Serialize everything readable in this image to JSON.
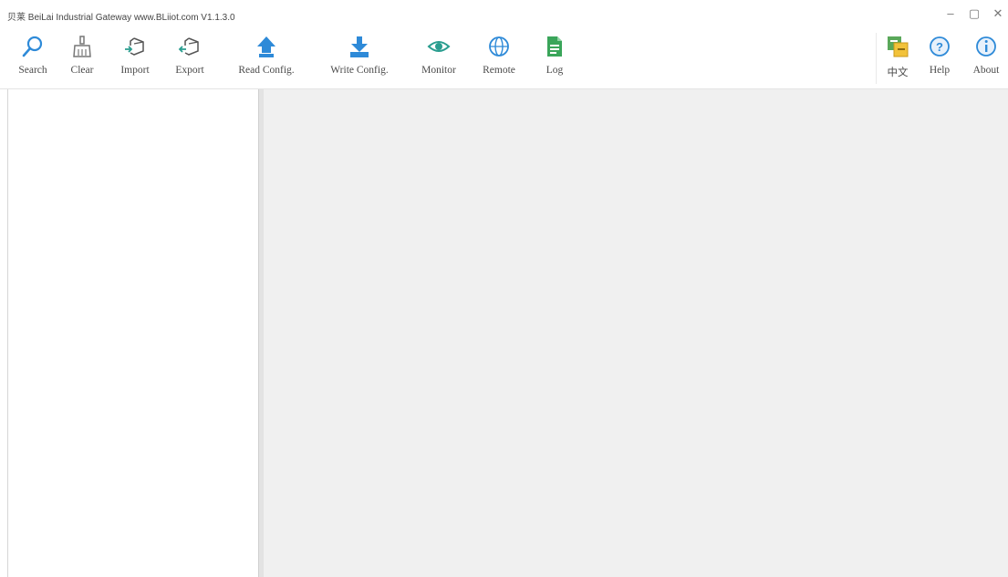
{
  "window": {
    "title": "贝莱 BeiLai Industrial Gateway www.BLiiot.com V1.1.3.0",
    "controls": {
      "minimize": "–",
      "maximize": "▢",
      "close": "✕"
    }
  },
  "toolbar": {
    "search": "Search",
    "clear": "Clear",
    "import": "Import",
    "export": "Export",
    "read_config": "Read Config.",
    "write_config": "Write Config.",
    "monitor": "Monitor",
    "remote": "Remote",
    "log": "Log",
    "language": "中文",
    "help": "Help",
    "about": "About"
  },
  "colors": {
    "accent_blue": "#2e8ad8",
    "accent_teal": "#2a9d8f",
    "accent_green": "#3aa55a",
    "workspace_bg": "#f0f0f0"
  }
}
